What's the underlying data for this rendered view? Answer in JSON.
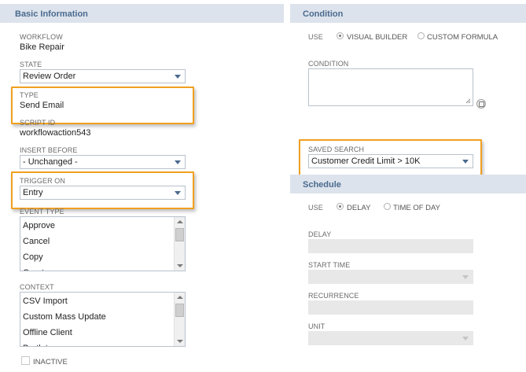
{
  "basic_info": {
    "header": "Basic Information",
    "workflow": {
      "label": "WORKFLOW",
      "value": "Bike Repair"
    },
    "state": {
      "label": "STATE",
      "value": "Review Order"
    },
    "type": {
      "label": "TYPE",
      "value": "Send Email"
    },
    "script_id": {
      "label": "SCRIPT ID",
      "value": "workflowaction543"
    },
    "insert_before": {
      "label": "INSERT BEFORE",
      "value": "- Unchanged -"
    },
    "trigger_on": {
      "label": "TRIGGER ON",
      "value": "Entry"
    },
    "event_type": {
      "label": "EVENT TYPE",
      "items": [
        "Approve",
        "Cancel",
        "Copy",
        "Create"
      ]
    },
    "context": {
      "label": "CONTEXT",
      "items": [
        "CSV Import",
        "Custom Mass Update",
        "Offline Client",
        "Portlet"
      ]
    },
    "inactive": {
      "label": "INACTIVE",
      "checked": false
    }
  },
  "condition": {
    "header": "Condition",
    "use_label": "USE",
    "options": [
      {
        "label": "VISUAL BUILDER",
        "checked": true
      },
      {
        "label": "CUSTOM FORMULA",
        "checked": false
      }
    ],
    "condition_label": "CONDITION",
    "saved_search": {
      "label": "SAVED SEARCH",
      "value": "Customer Credit Limit > 10K"
    }
  },
  "schedule": {
    "header": "Schedule",
    "use_label": "USE",
    "options": [
      {
        "label": "DELAY",
        "checked": true
      },
      {
        "label": "TIME OF DAY",
        "checked": false
      }
    ],
    "delay_label": "DELAY",
    "start_time_label": "START TIME",
    "recurrence_label": "RECURRENCE",
    "unit_label": "UNIT"
  },
  "colors": {
    "header_bg": "#dde3ec",
    "header_text": "#4a6a8e",
    "highlight": "#f0a020"
  }
}
